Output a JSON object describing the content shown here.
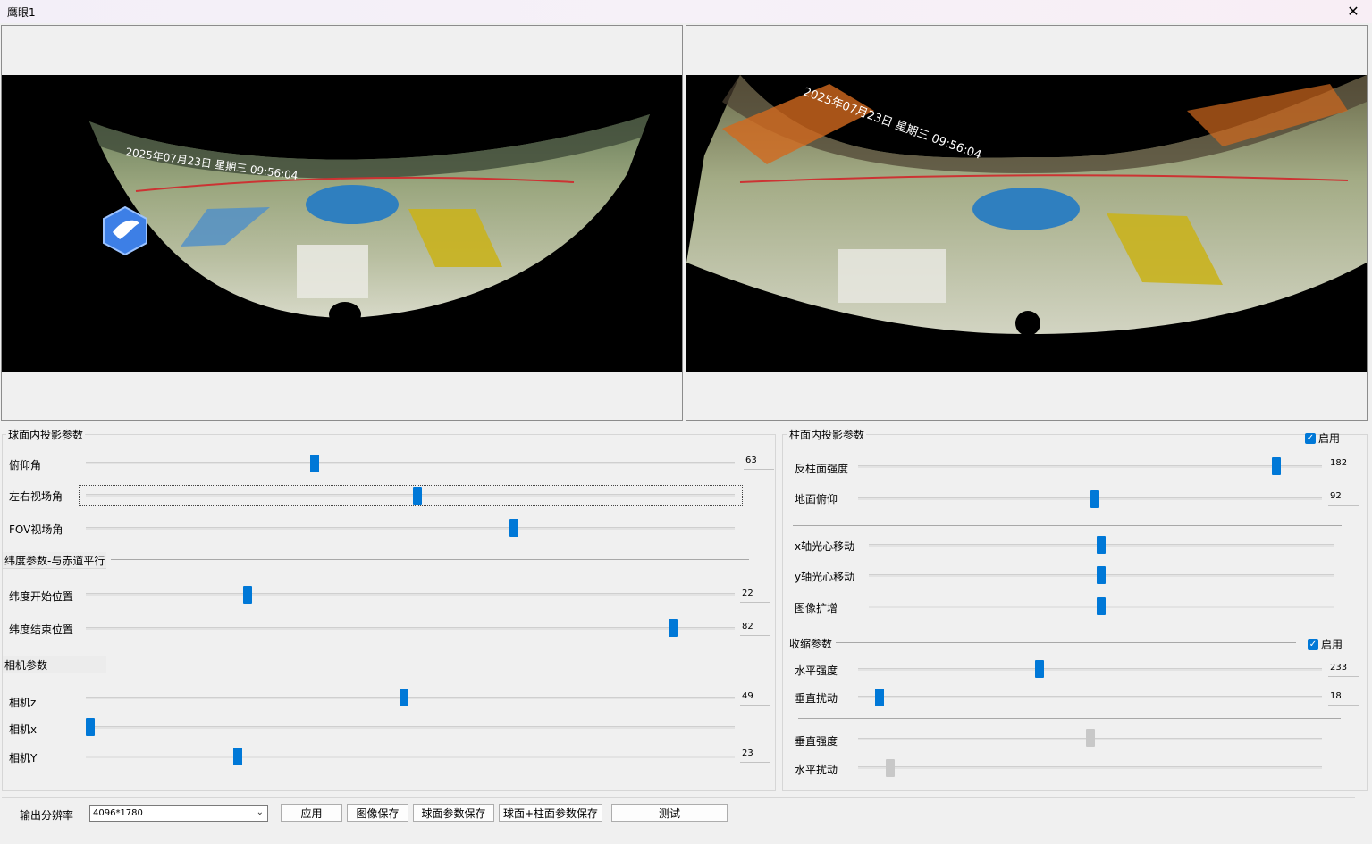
{
  "window": {
    "title": "鹰眼1"
  },
  "sphere_group": {
    "title": "球面内投影参数",
    "sliders": [
      {
        "label": "俯仰角",
        "value": 0.35,
        "readout": "63"
      },
      {
        "label": "左右视场角",
        "value": 0.5,
        "readout": ""
      },
      {
        "label": "FOV视场角",
        "value": 0.66,
        "readout": ""
      }
    ],
    "latitude_title": "纬度参数-与赤道平行",
    "latitude_sliders": [
      {
        "label": "纬度开始位置",
        "value": 0.25,
        "readout": "22"
      },
      {
        "label": "纬度结束位置",
        "value": 0.91,
        "readout": "82"
      }
    ],
    "camera_title": "相机参数",
    "camera_sliders": [
      {
        "label": "相机z",
        "value": 0.49,
        "readout": "49"
      },
      {
        "label": "相机x",
        "value": 0.0,
        "readout": ""
      },
      {
        "label": "相机Y",
        "value": 0.23,
        "readout": "23"
      }
    ]
  },
  "cylinder_group": {
    "title": "柱面内投影参数",
    "enable_label": "启用",
    "sliders": [
      {
        "label": "反柱面强度",
        "value": 0.89,
        "readout": "182"
      },
      {
        "label": "地面俯仰",
        "value": 0.51,
        "readout": "92"
      }
    ],
    "shift_sliders": [
      {
        "label": "x轴光心移动",
        "value": 0.5
      },
      {
        "label": "y轴光心移动",
        "value": 0.5
      },
      {
        "label": "图像扩增",
        "value": 0.5
      }
    ],
    "shrink_title": "收缩参数",
    "shrink_enable_label": "启用",
    "shrink_sliders": [
      {
        "label": "水平强度",
        "value": 0.39,
        "readout": "233"
      },
      {
        "label": "垂直扰动",
        "value": 0.04,
        "readout": "18"
      }
    ],
    "disabled_sliders": [
      {
        "label": "垂直强度",
        "value": 0.5
      },
      {
        "label": "水平扰动",
        "value": 0.07
      }
    ]
  },
  "footer": {
    "resolution_label": "输出分辨率",
    "resolution_value": "4096*1780",
    "buttons": {
      "apply": "应用",
      "save_image": "图像保存",
      "save_sphere": "球面参数保存",
      "save_both": "球面+柱面参数保存",
      "test": "测试"
    }
  },
  "overlay": {
    "left_timestamp": "2025年07月23日 星期三 09:56:04",
    "right_timestamp": "2025年07月23日 星期三 09:56:04"
  }
}
